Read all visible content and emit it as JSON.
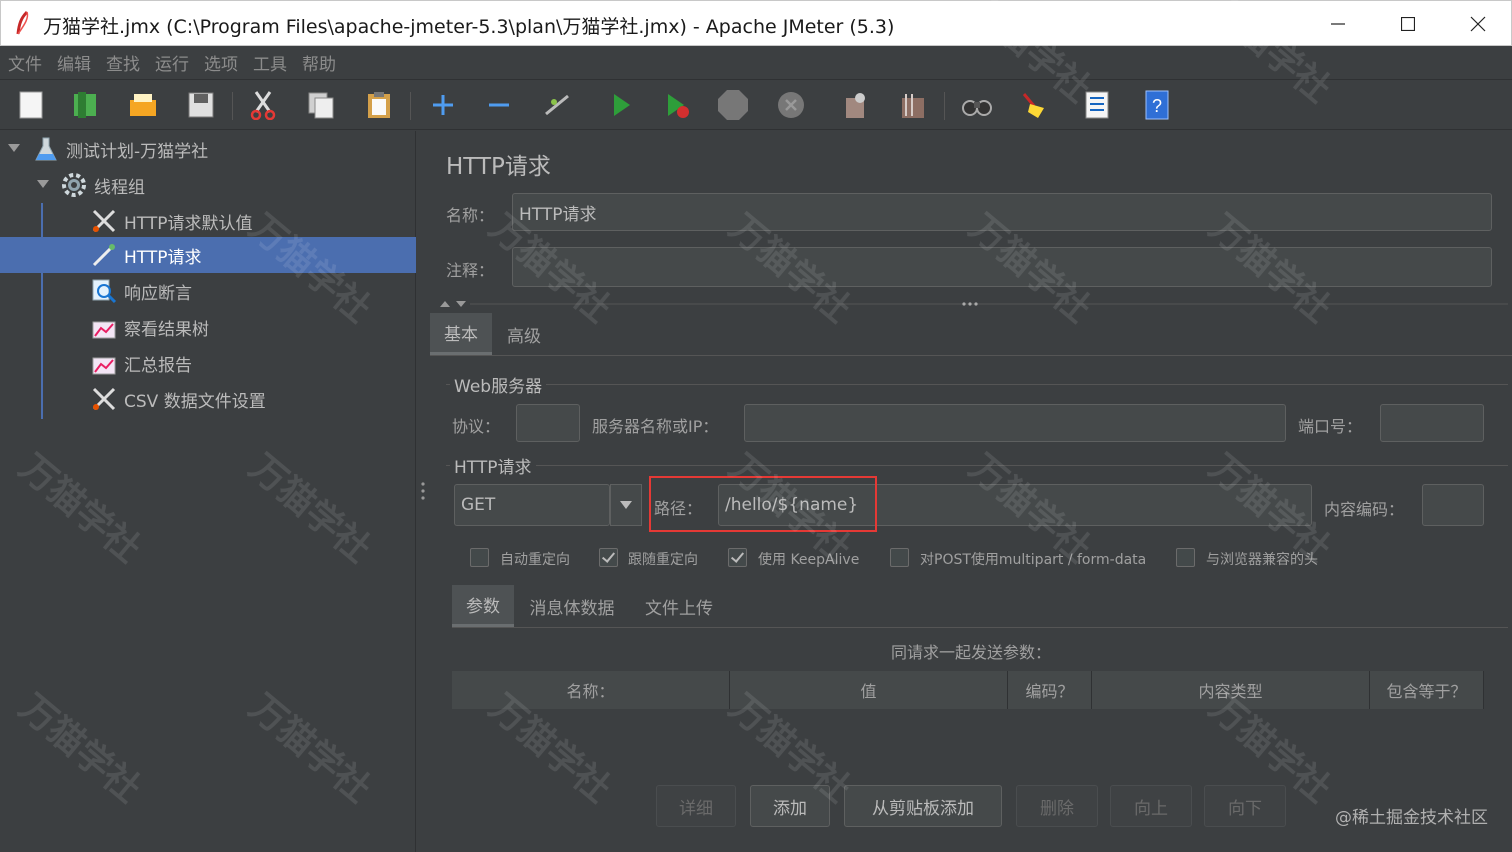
{
  "window": {
    "title": "万猫学社.jmx (C:\\Program Files\\apache-jmeter-5.3\\plan\\万猫学社.jmx) - Apache JMeter (5.3)"
  },
  "menu": [
    "文件",
    "编辑",
    "查找",
    "运行",
    "选项",
    "工具",
    "帮助"
  ],
  "toolbar_icons": [
    "new-icon",
    "templates-icon",
    "open-icon",
    "save-icon",
    "cut-icon",
    "copy-icon",
    "paste-icon",
    "expand-icon",
    "collapse-icon",
    "toggle-icon",
    "start-icon",
    "start-no-pause-icon",
    "stop-icon",
    "shutdown-icon",
    "clear-icon",
    "clear-all-icon",
    "search-icon",
    "reset-search-icon",
    "function-helper-icon",
    "help-icon"
  ],
  "tree": {
    "items": [
      {
        "label": "测试计划-万猫学社"
      },
      {
        "label": "线程组"
      },
      {
        "label": "HTTP请求默认值"
      },
      {
        "label": "HTTP请求"
      },
      {
        "label": "响应断言"
      },
      {
        "label": "察看结果树"
      },
      {
        "label": "汇总报告"
      },
      {
        "label": "CSV 数据文件设置"
      }
    ],
    "selected_index": 3
  },
  "panel": {
    "title": "HTTP请求",
    "name_label": "名称：",
    "name_value": "HTTP请求",
    "comment_label": "注释：",
    "comment_value": "",
    "tabs": [
      "基本",
      "高级"
    ],
    "web_server": {
      "group_title": "Web服务器",
      "protocol_label": "协议：",
      "protocol_value": "",
      "server_label": "服务器名称或IP：",
      "server_value": "",
      "port_label": "端口号：",
      "port_value": ""
    },
    "http_request": {
      "group_title": "HTTP请求",
      "method": "GET",
      "path_label": "路径：",
      "path_value": "/hello/${name}",
      "encoding_label": "内容编码：",
      "encoding_value": ""
    },
    "checkboxes": [
      {
        "label": "自动重定向",
        "checked": false
      },
      {
        "label": "跟随重定向",
        "checked": true
      },
      {
        "label": "使用 KeepAlive",
        "checked": true
      },
      {
        "label": "对POST使用multipart / form-data",
        "checked": false
      },
      {
        "label": "与浏览器兼容的头",
        "checked": false
      }
    ],
    "sub_tabs": [
      "参数",
      "消息体数据",
      "文件上传"
    ],
    "params_caption": "同请求一起发送参数：",
    "table_headers": [
      "名称：",
      "值",
      "编码？",
      "内容类型",
      "包含等于？"
    ],
    "buttons": [
      {
        "label": "详细",
        "enabled": false
      },
      {
        "label": "添加",
        "enabled": true
      },
      {
        "label": "从剪贴板添加",
        "enabled": true
      },
      {
        "label": "删除",
        "enabled": false
      },
      {
        "label": "向上",
        "enabled": false
      },
      {
        "label": "向下",
        "enabled": false
      }
    ]
  },
  "watermark": "万猫学社",
  "credit": "@稀土掘金技术社区",
  "colors": {
    "background": "#3c3f41",
    "selection": "#4b6eaf",
    "highlight": "#e53935"
  }
}
